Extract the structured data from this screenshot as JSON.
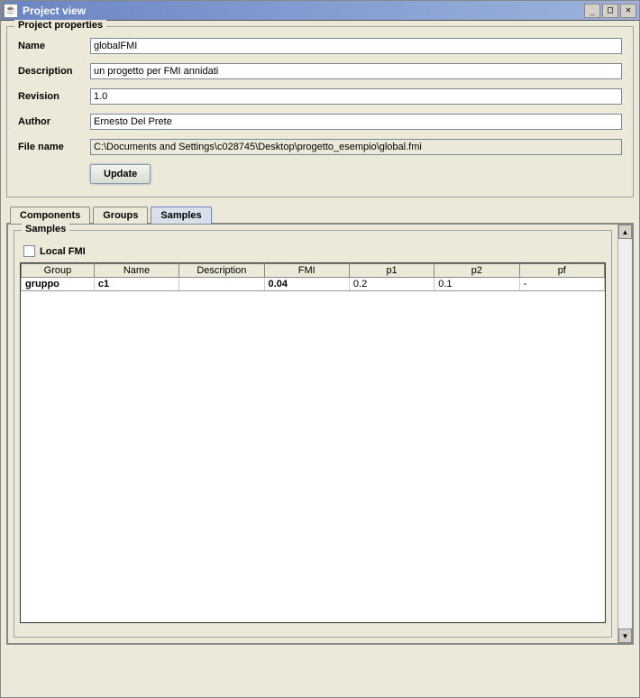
{
  "window": {
    "title": "Project view"
  },
  "properties": {
    "legend": "Project properties",
    "labels": {
      "name": "Name",
      "description": "Description",
      "revision": "Revision",
      "author": "Author",
      "filename": "File name"
    },
    "values": {
      "name": "globalFMI",
      "description": "un progetto per FMI annidati",
      "revision": "1.0",
      "author": "Ernesto Del Prete",
      "filename": "C:\\Documents and Settings\\c028745\\Desktop\\progetto_esempio\\global.fmi"
    },
    "update_label": "Update"
  },
  "tabs": {
    "components": "Components",
    "groups": "Groups",
    "samples": "Samples"
  },
  "samples": {
    "legend": "Samples",
    "local_fmi_label": "Local FMI",
    "headers": {
      "group": "Group",
      "name": "Name",
      "description": "Description",
      "fmi": "FMI",
      "p1": "p1",
      "p2": "p2",
      "pf": "pf"
    },
    "rows": [
      {
        "group": "gruppo",
        "name": "c1",
        "description": "",
        "fmi": "0.04",
        "p1": "0.2",
        "p2": "0.1",
        "pf": "-"
      }
    ]
  }
}
